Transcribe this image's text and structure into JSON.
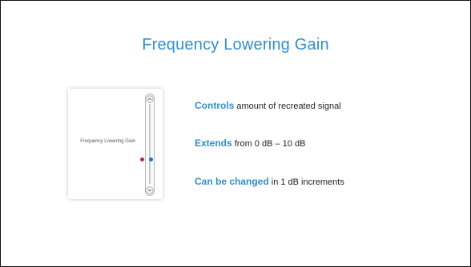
{
  "slide": {
    "title": "Frequency Lowering Gain"
  },
  "control": {
    "label": "Frequency Lowering Gain",
    "slider": {
      "up_icon": "chevron-up-icon",
      "down_icon": "chevron-down-icon",
      "red_marker_color": "#cc2222",
      "blue_marker_color": "#2a6fd6"
    }
  },
  "bullets": [
    {
      "keyword": "Controls",
      "text": " amount of recreated signal"
    },
    {
      "keyword": "Extends",
      "text": " from 0 dB – 10 dB"
    },
    {
      "keyword": "Can be changed",
      "text": " in 1 dB increments"
    }
  ],
  "colors": {
    "accent": "#2f8fcf"
  }
}
